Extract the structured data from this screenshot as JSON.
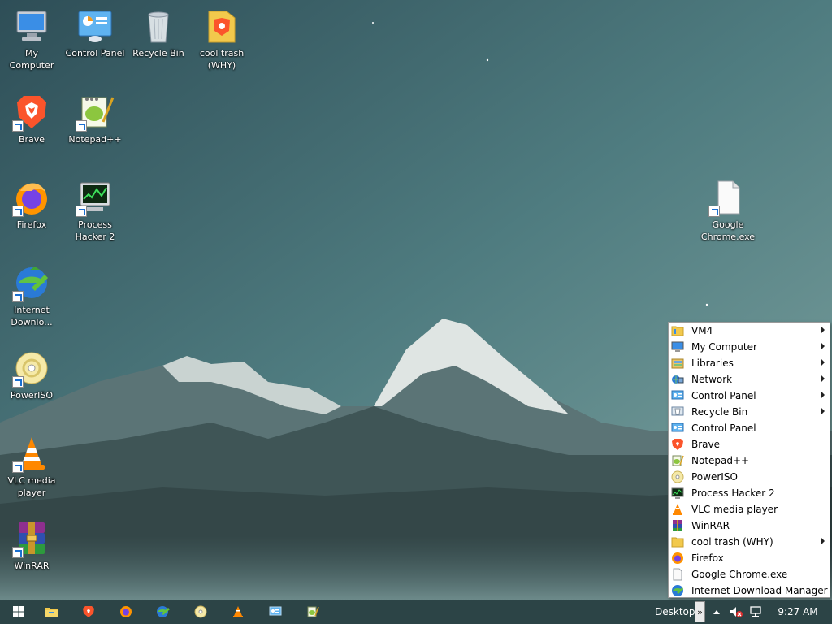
{
  "desktop_icons": [
    {
      "label": "My Computer"
    },
    {
      "label": "Control Panel"
    },
    {
      "label": "Recycle Bin"
    },
    {
      "label": "cool trash (WHY)"
    },
    {
      "label": "Brave"
    },
    {
      "label": "Notepad++"
    },
    {
      "label": "Firefox"
    },
    {
      "label": "Process Hacker 2"
    },
    {
      "label": "Google Chrome.exe"
    },
    {
      "label": "Internet Downlo..."
    },
    {
      "label": "PowerISO"
    },
    {
      "label": "VLC media player"
    },
    {
      "label": "WinRAR"
    }
  ],
  "menu": {
    "items": [
      {
        "label": "VM4",
        "icon": "folder-icon",
        "submenu": true
      },
      {
        "label": "My Computer",
        "icon": "computer-icon",
        "submenu": true
      },
      {
        "label": "Libraries",
        "icon": "libraries-icon",
        "submenu": true
      },
      {
        "label": "Network",
        "icon": "network-icon",
        "submenu": true
      },
      {
        "label": "Control Panel",
        "icon": "control-panel-icon",
        "submenu": true
      },
      {
        "label": "Recycle Bin",
        "icon": "recycle-bin-icon",
        "submenu": true
      },
      {
        "label": "Control Panel",
        "icon": "control-panel-icon",
        "submenu": false
      },
      {
        "label": "Brave",
        "icon": "brave-icon",
        "submenu": false
      },
      {
        "label": "Notepad++",
        "icon": "notepad-plus-plus-icon",
        "submenu": false
      },
      {
        "label": "PowerISO",
        "icon": "poweriso-icon",
        "submenu": false
      },
      {
        "label": "Process Hacker 2",
        "icon": "process-hacker-icon",
        "submenu": false
      },
      {
        "label": "VLC media player",
        "icon": "vlc-icon",
        "submenu": false
      },
      {
        "label": "WinRAR",
        "icon": "winrar-icon",
        "submenu": false
      },
      {
        "label": "cool trash (WHY)",
        "icon": "folder-icon",
        "submenu": true
      },
      {
        "label": "Firefox",
        "icon": "firefox-icon",
        "submenu": false
      },
      {
        "label": "Google Chrome.exe",
        "icon": "blank-file-icon",
        "submenu": false
      },
      {
        "label": "Internet Download Manager",
        "icon": "idm-icon",
        "submenu": false
      }
    ]
  },
  "taskbar": {
    "toolbar_label": "Desktop",
    "toolbar_chevron": "»",
    "clock": "9:27 AM",
    "pinned": [
      "start-icon",
      "file-explorer-icon",
      "brave-icon",
      "firefox-icon",
      "idm-icon",
      "poweriso-icon",
      "vlc-icon",
      "control-panel-icon",
      "notepad-plus-plus-icon"
    ]
  },
  "colors": {
    "taskbar_bg": "#2c4446",
    "menu_bg": "#ffffff",
    "sky": "#4d7278"
  }
}
